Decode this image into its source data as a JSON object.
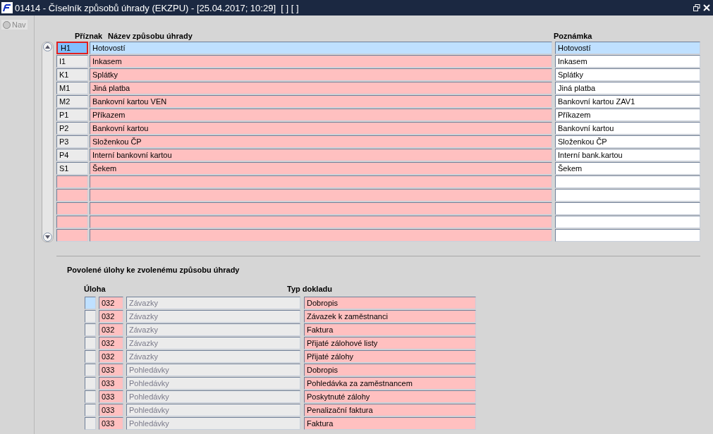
{
  "window": {
    "title": "01414 - Číselník způsobů úhrady (EKZPU) - [25.04.2017; 10:29]  [ ] [ ]"
  },
  "nav": {
    "label": "Nav",
    "selected": false
  },
  "master": {
    "columns": [
      "Příznak",
      "Název způsobu úhrady",
      "Poznámka"
    ],
    "rows": [
      {
        "code": "H1",
        "name": "Hotovostí",
        "note": "Hotovostí",
        "selected": true
      },
      {
        "code": "I1",
        "name": "Inkasem",
        "note": "Inkasem",
        "selected": false
      },
      {
        "code": "K1",
        "name": "Splátky",
        "note": "Splátky",
        "selected": false
      },
      {
        "code": "M1",
        "name": "Jiná platba",
        "note": "Jiná platba",
        "selected": false
      },
      {
        "code": "M2",
        "name": "Bankovní kartou VEN",
        "note": "Bankovní kartou ZAV1",
        "selected": false
      },
      {
        "code": "P1",
        "name": "Příkazem",
        "note": "Příkazem",
        "selected": false
      },
      {
        "code": "P2",
        "name": "Bankovní kartou",
        "note": "Bankovní kartou",
        "selected": false
      },
      {
        "code": "P3",
        "name": "Složenkou ČP",
        "note": "Složenkou ČP",
        "selected": false
      },
      {
        "code": "P4",
        "name": "Interní bankovní kartou",
        "note": "Interní bank.kartou",
        "selected": false
      },
      {
        "code": "S1",
        "name": "Šekem",
        "note": "Šekem",
        "selected": false
      },
      {
        "selected": false
      },
      {
        "selected": false
      },
      {
        "selected": false
      },
      {
        "selected": false
      },
      {
        "selected": false
      }
    ]
  },
  "detail": {
    "title": "Povolené úlohy ke zvolenému způsobu úhrady",
    "columns": [
      "Úloha",
      "Typ dokladu"
    ],
    "rows": [
      {
        "code": "032",
        "task": "Závazky",
        "type": "Dobropis",
        "selected": true
      },
      {
        "code": "032",
        "task": "Závazky",
        "type": "Závazek k zaměstnanci",
        "selected": false
      },
      {
        "code": "032",
        "task": "Závazky",
        "type": "Faktura",
        "selected": false
      },
      {
        "code": "032",
        "task": "Závazky",
        "type": "Přijaté zálohové listy",
        "selected": false
      },
      {
        "code": "032",
        "task": "Závazky",
        "type": "Přijaté zálohy",
        "selected": false
      },
      {
        "code": "033",
        "task": "Pohledávky",
        "type": "Dobropis",
        "selected": false
      },
      {
        "code": "033",
        "task": "Pohledávky",
        "type": "Pohledávka za zaměstnancem",
        "selected": false
      },
      {
        "code": "033",
        "task": "Pohledávky",
        "type": "Poskytnuté zálohy",
        "selected": false
      },
      {
        "code": "033",
        "task": "Pohledávky",
        "type": "Penalizační faktura",
        "selected": false
      },
      {
        "code": "033",
        "task": "Pohledávky",
        "type": "Faktura",
        "selected": false
      }
    ]
  }
}
